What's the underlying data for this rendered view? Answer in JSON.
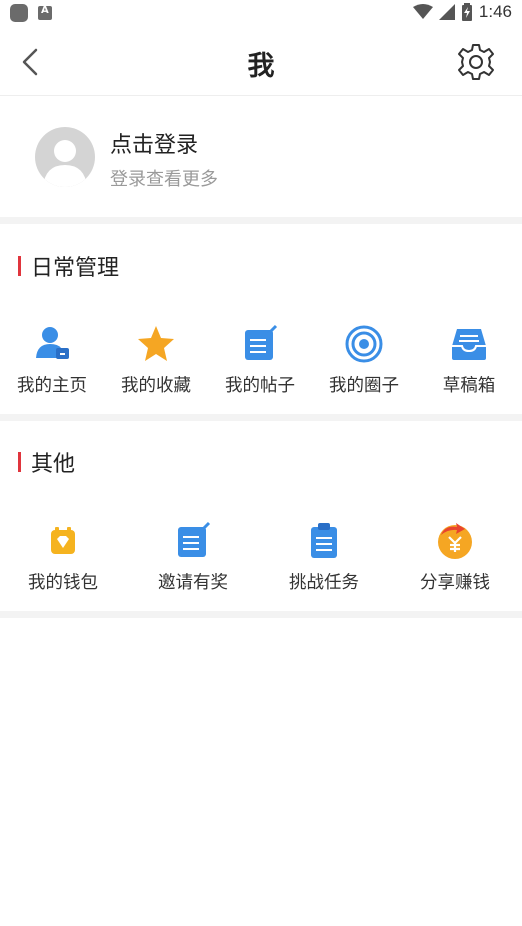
{
  "status_bar": {
    "time": "1:46",
    "left_icons": [
      "app-icon",
      "a-letter-icon"
    ],
    "right_icons": [
      "wifi-icon",
      "signal-icon",
      "battery-icon"
    ]
  },
  "header": {
    "title": "我",
    "back_icon": "chevron-left-icon",
    "settings_icon": "gear-icon"
  },
  "profile": {
    "login_title": "点击登录",
    "login_subtitle": "登录查看更多"
  },
  "sections": [
    {
      "title": "日常管理",
      "items": [
        {
          "label": "我的主页",
          "icon": "user-home-icon"
        },
        {
          "label": "我的收藏",
          "icon": "star-icon"
        },
        {
          "label": "我的帖子",
          "icon": "post-edit-icon"
        },
        {
          "label": "我的圈子",
          "icon": "circle-target-icon"
        },
        {
          "label": "草稿箱",
          "icon": "drafts-box-icon"
        }
      ]
    },
    {
      "title": "其他",
      "items": [
        {
          "label": "我的钱包",
          "icon": "wallet-icon"
        },
        {
          "label": "邀请有奖",
          "icon": "invite-edit-icon"
        },
        {
          "label": "挑战任务",
          "icon": "clipboard-task-icon"
        },
        {
          "label": "分享赚钱",
          "icon": "share-money-icon"
        }
      ]
    }
  ],
  "colors": {
    "accent_red": "#e0353d",
    "icon_blue": "#3a8ee6",
    "star_orange": "#f5a623",
    "divider_gray": "#f3f3f3"
  }
}
